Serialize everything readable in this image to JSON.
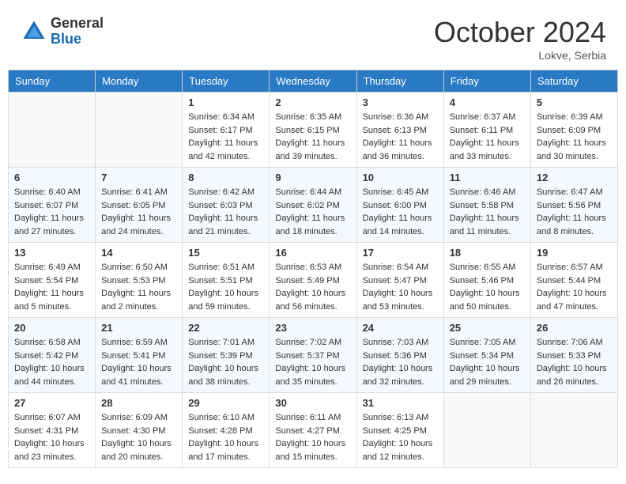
{
  "header": {
    "logo_general": "General",
    "logo_blue": "Blue",
    "month_title": "October 2024",
    "location": "Lokve, Serbia"
  },
  "calendar": {
    "days_of_week": [
      "Sunday",
      "Monday",
      "Tuesday",
      "Wednesday",
      "Thursday",
      "Friday",
      "Saturday"
    ],
    "weeks": [
      [
        {
          "day": "",
          "sunrise": "",
          "sunset": "",
          "daylight": ""
        },
        {
          "day": "",
          "sunrise": "",
          "sunset": "",
          "daylight": ""
        },
        {
          "day": "1",
          "sunrise": "Sunrise: 6:34 AM",
          "sunset": "Sunset: 6:17 PM",
          "daylight": "Daylight: 11 hours and 42 minutes."
        },
        {
          "day": "2",
          "sunrise": "Sunrise: 6:35 AM",
          "sunset": "Sunset: 6:15 PM",
          "daylight": "Daylight: 11 hours and 39 minutes."
        },
        {
          "day": "3",
          "sunrise": "Sunrise: 6:36 AM",
          "sunset": "Sunset: 6:13 PM",
          "daylight": "Daylight: 11 hours and 36 minutes."
        },
        {
          "day": "4",
          "sunrise": "Sunrise: 6:37 AM",
          "sunset": "Sunset: 6:11 PM",
          "daylight": "Daylight: 11 hours and 33 minutes."
        },
        {
          "day": "5",
          "sunrise": "Sunrise: 6:39 AM",
          "sunset": "Sunset: 6:09 PM",
          "daylight": "Daylight: 11 hours and 30 minutes."
        }
      ],
      [
        {
          "day": "6",
          "sunrise": "Sunrise: 6:40 AM",
          "sunset": "Sunset: 6:07 PM",
          "daylight": "Daylight: 11 hours and 27 minutes."
        },
        {
          "day": "7",
          "sunrise": "Sunrise: 6:41 AM",
          "sunset": "Sunset: 6:05 PM",
          "daylight": "Daylight: 11 hours and 24 minutes."
        },
        {
          "day": "8",
          "sunrise": "Sunrise: 6:42 AM",
          "sunset": "Sunset: 6:03 PM",
          "daylight": "Daylight: 11 hours and 21 minutes."
        },
        {
          "day": "9",
          "sunrise": "Sunrise: 6:44 AM",
          "sunset": "Sunset: 6:02 PM",
          "daylight": "Daylight: 11 hours and 18 minutes."
        },
        {
          "day": "10",
          "sunrise": "Sunrise: 6:45 AM",
          "sunset": "Sunset: 6:00 PM",
          "daylight": "Daylight: 11 hours and 14 minutes."
        },
        {
          "day": "11",
          "sunrise": "Sunrise: 6:46 AM",
          "sunset": "Sunset: 5:58 PM",
          "daylight": "Daylight: 11 hours and 11 minutes."
        },
        {
          "day": "12",
          "sunrise": "Sunrise: 6:47 AM",
          "sunset": "Sunset: 5:56 PM",
          "daylight": "Daylight: 11 hours and 8 minutes."
        }
      ],
      [
        {
          "day": "13",
          "sunrise": "Sunrise: 6:49 AM",
          "sunset": "Sunset: 5:54 PM",
          "daylight": "Daylight: 11 hours and 5 minutes."
        },
        {
          "day": "14",
          "sunrise": "Sunrise: 6:50 AM",
          "sunset": "Sunset: 5:53 PM",
          "daylight": "Daylight: 11 hours and 2 minutes."
        },
        {
          "day": "15",
          "sunrise": "Sunrise: 6:51 AM",
          "sunset": "Sunset: 5:51 PM",
          "daylight": "Daylight: 10 hours and 59 minutes."
        },
        {
          "day": "16",
          "sunrise": "Sunrise: 6:53 AM",
          "sunset": "Sunset: 5:49 PM",
          "daylight": "Daylight: 10 hours and 56 minutes."
        },
        {
          "day": "17",
          "sunrise": "Sunrise: 6:54 AM",
          "sunset": "Sunset: 5:47 PM",
          "daylight": "Daylight: 10 hours and 53 minutes."
        },
        {
          "day": "18",
          "sunrise": "Sunrise: 6:55 AM",
          "sunset": "Sunset: 5:46 PM",
          "daylight": "Daylight: 10 hours and 50 minutes."
        },
        {
          "day": "19",
          "sunrise": "Sunrise: 6:57 AM",
          "sunset": "Sunset: 5:44 PM",
          "daylight": "Daylight: 10 hours and 47 minutes."
        }
      ],
      [
        {
          "day": "20",
          "sunrise": "Sunrise: 6:58 AM",
          "sunset": "Sunset: 5:42 PM",
          "daylight": "Daylight: 10 hours and 44 minutes."
        },
        {
          "day": "21",
          "sunrise": "Sunrise: 6:59 AM",
          "sunset": "Sunset: 5:41 PM",
          "daylight": "Daylight: 10 hours and 41 minutes."
        },
        {
          "day": "22",
          "sunrise": "Sunrise: 7:01 AM",
          "sunset": "Sunset: 5:39 PM",
          "daylight": "Daylight: 10 hours and 38 minutes."
        },
        {
          "day": "23",
          "sunrise": "Sunrise: 7:02 AM",
          "sunset": "Sunset: 5:37 PM",
          "daylight": "Daylight: 10 hours and 35 minutes."
        },
        {
          "day": "24",
          "sunrise": "Sunrise: 7:03 AM",
          "sunset": "Sunset: 5:36 PM",
          "daylight": "Daylight: 10 hours and 32 minutes."
        },
        {
          "day": "25",
          "sunrise": "Sunrise: 7:05 AM",
          "sunset": "Sunset: 5:34 PM",
          "daylight": "Daylight: 10 hours and 29 minutes."
        },
        {
          "day": "26",
          "sunrise": "Sunrise: 7:06 AM",
          "sunset": "Sunset: 5:33 PM",
          "daylight": "Daylight: 10 hours and 26 minutes."
        }
      ],
      [
        {
          "day": "27",
          "sunrise": "Sunrise: 6:07 AM",
          "sunset": "Sunset: 4:31 PM",
          "daylight": "Daylight: 10 hours and 23 minutes."
        },
        {
          "day": "28",
          "sunrise": "Sunrise: 6:09 AM",
          "sunset": "Sunset: 4:30 PM",
          "daylight": "Daylight: 10 hours and 20 minutes."
        },
        {
          "day": "29",
          "sunrise": "Sunrise: 6:10 AM",
          "sunset": "Sunset: 4:28 PM",
          "daylight": "Daylight: 10 hours and 17 minutes."
        },
        {
          "day": "30",
          "sunrise": "Sunrise: 6:11 AM",
          "sunset": "Sunset: 4:27 PM",
          "daylight": "Daylight: 10 hours and 15 minutes."
        },
        {
          "day": "31",
          "sunrise": "Sunrise: 6:13 AM",
          "sunset": "Sunset: 4:25 PM",
          "daylight": "Daylight: 10 hours and 12 minutes."
        },
        {
          "day": "",
          "sunrise": "",
          "sunset": "",
          "daylight": ""
        },
        {
          "day": "",
          "sunrise": "",
          "sunset": "",
          "daylight": ""
        }
      ]
    ]
  }
}
